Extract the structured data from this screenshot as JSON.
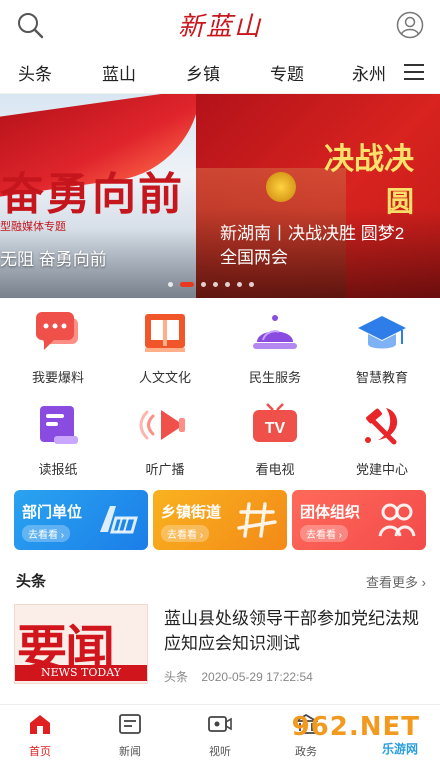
{
  "app": {
    "logo_text": "新蓝山"
  },
  "topbar": {
    "search_icon": "search-icon",
    "user_icon": "user-icon"
  },
  "category_tabs": [
    {
      "label": "头条"
    },
    {
      "label": "蓝山"
    },
    {
      "label": "乡镇"
    },
    {
      "label": "专题"
    },
    {
      "label": "永州"
    }
  ],
  "banner": {
    "slide_left": {
      "headline": "奋勇向前",
      "subtext": "型融媒体专题",
      "caption": "无阻 奋勇向前"
    },
    "slide_right": {
      "headline": "决战决",
      "headline2": "圆",
      "caption_line1": "新湖南丨决战决胜 圆梦2",
      "caption_line2": "全国两会"
    },
    "dots_count": 7,
    "active_dot": 1
  },
  "grid": [
    {
      "label": "我要爆料",
      "icon": "chat-bubble-icon",
      "color": "#f0504a"
    },
    {
      "label": "人文文化",
      "icon": "book-icon",
      "color": "#f0562a"
    },
    {
      "label": "民生服务",
      "icon": "service-bell-icon",
      "color": "#8a4be0"
    },
    {
      "label": "智慧教育",
      "icon": "graduation-cap-icon",
      "color": "#2f7de8"
    },
    {
      "label": "读报纸",
      "icon": "newspaper-icon",
      "color": "#8a4be0"
    },
    {
      "label": "听广播",
      "icon": "broadcast-icon",
      "color": "#f0504a"
    },
    {
      "label": "看电视",
      "icon": "tv-icon",
      "color": "#f0504a"
    },
    {
      "label": "党建中心",
      "icon": "hammer-sickle-icon",
      "color": "#e8262a"
    }
  ],
  "cards": [
    {
      "title": "部门单位",
      "button": "去看看 ›",
      "color_a": "#2aa3f0",
      "color_b": "#1b7ee8"
    },
    {
      "title": "乡镇街道",
      "button": "去看看 ›",
      "color_a": "#f9b21f",
      "color_b": "#f38a18"
    },
    {
      "title": "团体组织",
      "button": "去看看 ›",
      "color_a": "#ff6a5a",
      "color_b": "#f24a4a"
    }
  ],
  "section": {
    "title": "头条",
    "more": "查看更多 ›"
  },
  "news": [
    {
      "thumb_big": "要闻",
      "thumb_bar": "NEWS TODAY",
      "title": "蓝山县处级领导干部参加党纪法规应知应会知识测试",
      "source": "头条",
      "time": "2020-05-29 17:22:54"
    }
  ],
  "bottom_nav": [
    {
      "label": "首页",
      "icon": "home-icon",
      "active": true
    },
    {
      "label": "新闻",
      "icon": "news-icon",
      "active": false
    },
    {
      "label": "视听",
      "icon": "video-icon",
      "active": false
    },
    {
      "label": "政务",
      "icon": "government-icon",
      "active": false
    }
  ],
  "watermark": {
    "text": "962.NET",
    "sub": "乐游网"
  },
  "colors": {
    "accent": "#e02020",
    "logo": "#c8161d"
  }
}
